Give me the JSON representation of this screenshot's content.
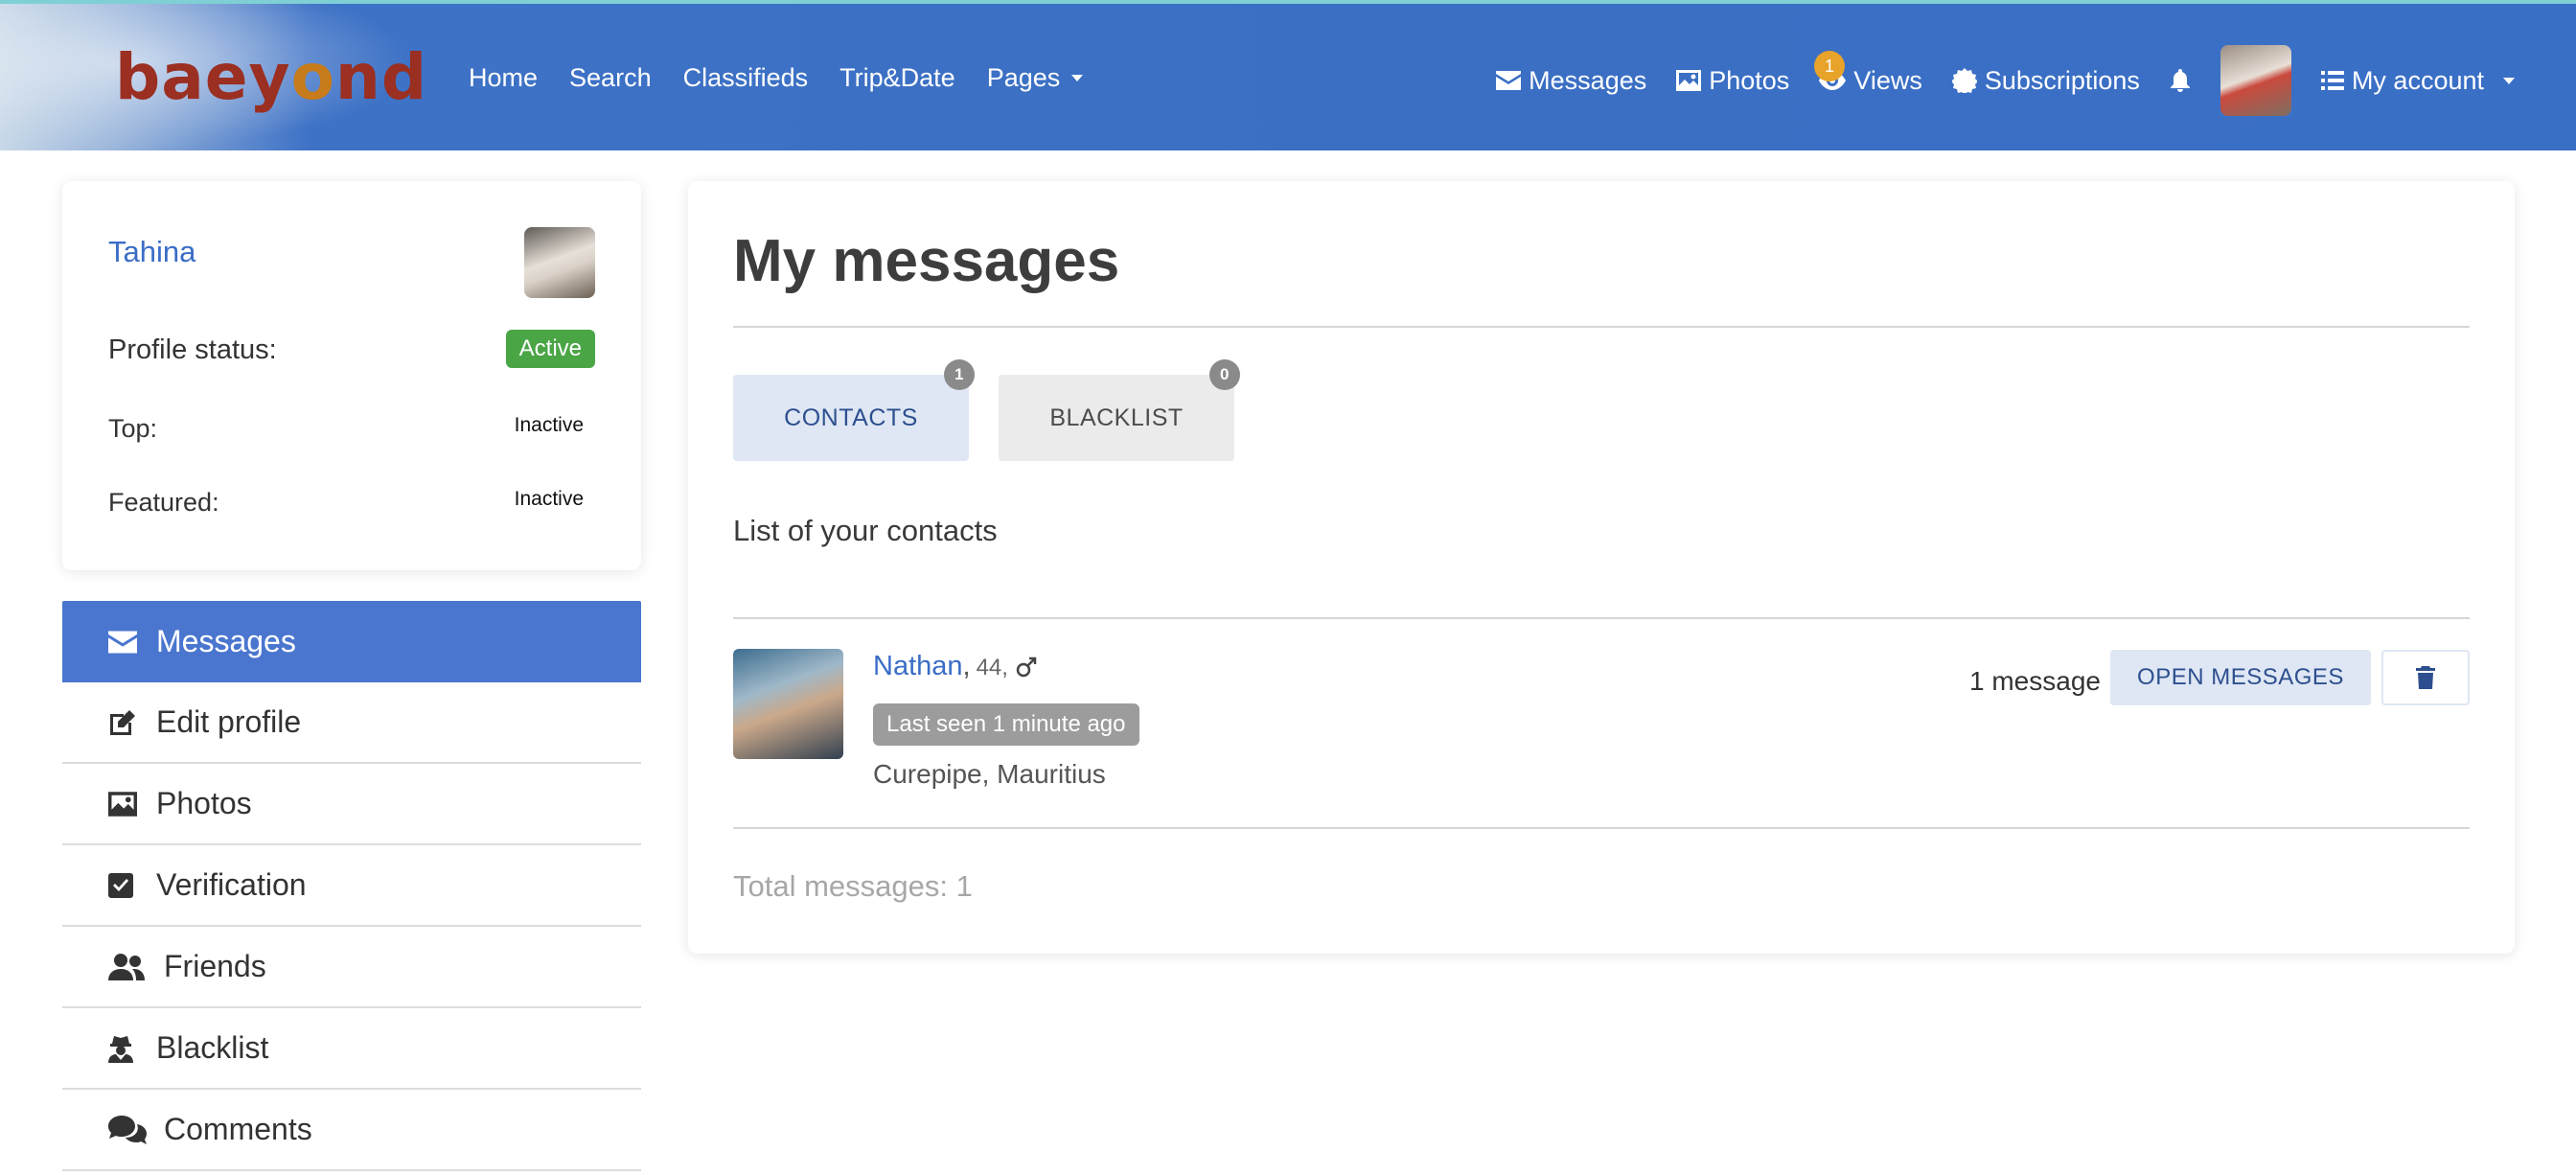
{
  "brand": {
    "logo_text_a": "baey",
    "logo_text_o": "o",
    "logo_text_b": "nd"
  },
  "colors": {
    "accent": "#3a6fc4",
    "active_green": "#4aa545",
    "views_badge": "#e8a32b"
  },
  "nav": {
    "left": [
      {
        "label": "Home"
      },
      {
        "label": "Search"
      },
      {
        "label": "Classifieds"
      },
      {
        "label": "Trip&Date"
      },
      {
        "label": "Pages",
        "icon": "caret-down-icon"
      }
    ],
    "right": {
      "messages": {
        "label": "Messages",
        "icon": "envelope-icon"
      },
      "photos": {
        "label": "Photos",
        "icon": "image-icon"
      },
      "views": {
        "label": "Views",
        "icon": "eye-icon",
        "badge": "1"
      },
      "subscriptions": {
        "label": "Subscriptions",
        "icon": "badge-icon"
      },
      "notifications": {
        "icon": "bell-icon"
      },
      "account": {
        "label": "My account",
        "icon": "list-icon"
      }
    }
  },
  "profile": {
    "name": "Tahina",
    "status_label": "Profile status:",
    "status_value": "Active",
    "top_label": "Top:",
    "top_value": "Inactive",
    "featured_label": "Featured:",
    "featured_value": "Inactive"
  },
  "sidebar": {
    "items": [
      {
        "label": "Messages",
        "icon": "envelope-icon",
        "active": true
      },
      {
        "label": "Edit profile",
        "icon": "edit-icon"
      },
      {
        "label": "Photos",
        "icon": "image-icon"
      },
      {
        "label": "Verification",
        "icon": "check-square-icon"
      },
      {
        "label": "Friends",
        "icon": "users-icon"
      },
      {
        "label": "Blacklist",
        "icon": "user-secret-icon"
      },
      {
        "label": "Comments",
        "icon": "comments-icon"
      }
    ]
  },
  "main": {
    "title": "My messages",
    "tabs": [
      {
        "label": "CONTACTS",
        "count": "1"
      },
      {
        "label": "BLACKLIST",
        "count": "0"
      }
    ],
    "list_title": "List of your contacts",
    "contact": {
      "name": "Nathan",
      "separator": ",",
      "age": "44,",
      "gender_icon": "male-icon",
      "last_seen": "Last seen 1 minute ago",
      "location": "Curepipe, Mauritius",
      "message_count": "1 message",
      "open_label": "OPEN MESSAGES",
      "delete_icon": "trash-icon"
    },
    "total": "Total messages: 1"
  }
}
